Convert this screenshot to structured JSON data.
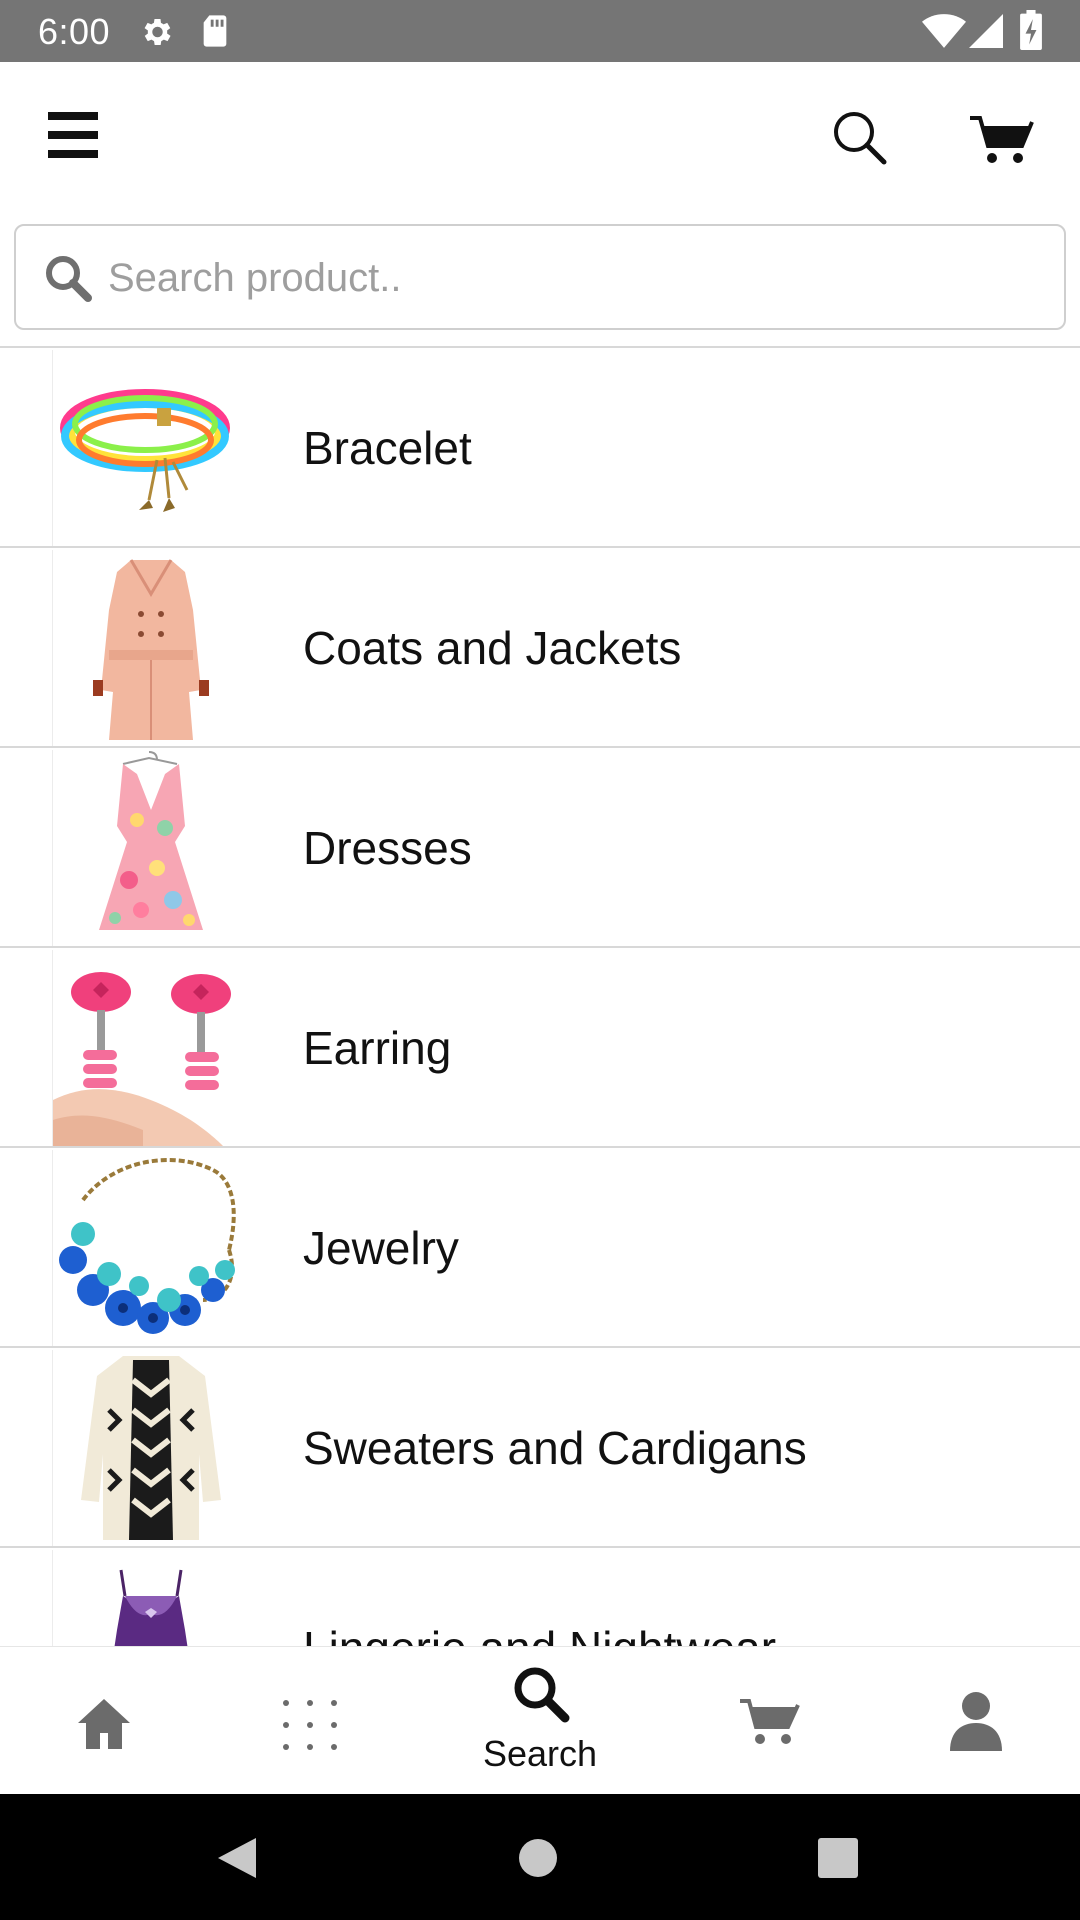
{
  "status_bar": {
    "time": "6:00",
    "icons": [
      "gear-icon",
      "sd-card-icon",
      "wifi-icon",
      "signal-icon",
      "battery-icon"
    ]
  },
  "top_bar": {
    "menu_icon": "hamburger-menu-icon",
    "search_icon": "search-icon",
    "cart_icon": "cart-icon"
  },
  "search": {
    "placeholder": "Search product..",
    "value": ""
  },
  "categories": [
    {
      "label": "Bracelet",
      "image": "bracelet-thumbnail"
    },
    {
      "label": "Coats and Jackets",
      "image": "coat-thumbnail"
    },
    {
      "label": "Dresses",
      "image": "dress-thumbnail"
    },
    {
      "label": "Earring",
      "image": "earring-thumbnail"
    },
    {
      "label": "Jewelry",
      "image": "necklace-thumbnail"
    },
    {
      "label": "Sweaters and Cardigans",
      "image": "cardigan-thumbnail"
    },
    {
      "label": "Lingerie and Nightwear",
      "image": "lingerie-thumbnail"
    }
  ],
  "bottom_nav": {
    "items": [
      {
        "name": "home",
        "icon": "home-icon",
        "label": ""
      },
      {
        "name": "categories",
        "icon": "grid-dots-icon",
        "label": ""
      },
      {
        "name": "search",
        "icon": "search-icon",
        "label": "Search",
        "active": true
      },
      {
        "name": "cart",
        "icon": "cart-icon",
        "label": ""
      },
      {
        "name": "account",
        "icon": "person-icon",
        "label": ""
      }
    ]
  },
  "system_nav": {
    "icons": [
      "back-icon",
      "home-circle-icon",
      "recents-icon"
    ]
  },
  "colors": {
    "status_bar": "#757575",
    "divider": "#d8d8d8",
    "inactive_icon": "#6b6b6b",
    "active_icon": "#111111",
    "system_nav_bg": "#000000"
  }
}
